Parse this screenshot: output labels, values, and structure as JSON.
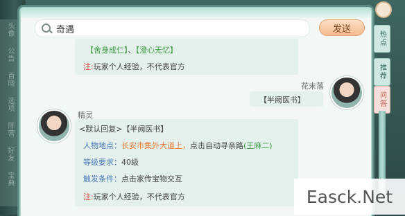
{
  "search": {
    "value": "奇遇"
  },
  "send_label": "发送",
  "messages": {
    "m1": {
      "reward_a": "【舍身成仁】",
      "reward_sep": "、",
      "reward_b": "【澄心无忆】",
      "note_label": "注:",
      "note_text": "玩家个人经验，不代表官方"
    },
    "m2": {
      "sender": "花末落",
      "text": "【半阙医书】"
    },
    "m3": {
      "sender": "精灵",
      "title": "<默认回复>【半阙医书】",
      "location_label": "人物地点：",
      "location_value": "长安市集外大道上，",
      "location_action": "点击自动寻亲路",
      "location_npc": "(王麻二)",
      "level_label": "等级要求：",
      "level_value": "40级",
      "trigger_label": "触发条件：",
      "trigger_value": "点击家传宝物交互",
      "note_label": "注:",
      "note_text": "玩家个人经验，不代表官方"
    }
  },
  "tabs": [
    "热点",
    "推荐",
    "问答"
  ],
  "left_tabs": [
    "头像",
    "公告",
    "百晓",
    "选项",
    "阵营",
    "好友",
    "宝典"
  ],
  "watermark": "Easck.Net"
}
